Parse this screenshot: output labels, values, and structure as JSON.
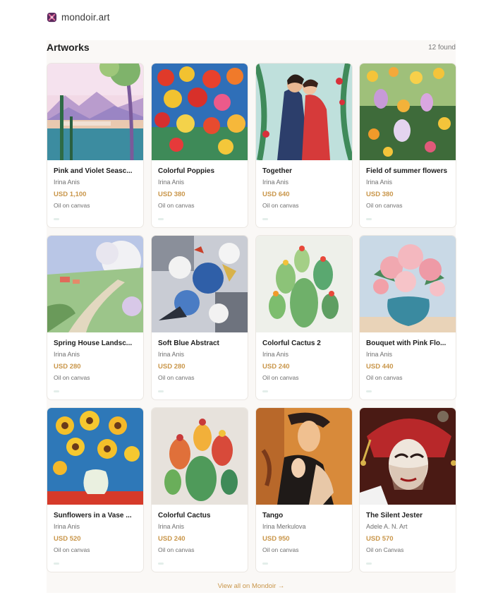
{
  "header": {
    "brand": "mondoir.art",
    "logo_icon": "logo-mark-icon"
  },
  "section": {
    "title": "Artworks",
    "count": "12 found"
  },
  "artworks": [
    {
      "title": "Pink and Violet Seasc...",
      "artist": "Irina Anis",
      "price": "USD 1,100",
      "medium": "Oil on canvas"
    },
    {
      "title": "Colorful Poppies",
      "artist": "Irina Anis",
      "price": "USD 380",
      "medium": "Oil on canvas"
    },
    {
      "title": "Together",
      "artist": "Irina Anis",
      "price": "USD 640",
      "medium": "Oil on canvas"
    },
    {
      "title": "Field of summer flowers",
      "artist": "Irina Anis",
      "price": "USD 380",
      "medium": "Oil on canvas"
    },
    {
      "title": "Spring House Landsc...",
      "artist": "Irina Anis",
      "price": "USD 280",
      "medium": "Oil on canvas"
    },
    {
      "title": "Soft Blue Abstract",
      "artist": "Irina Anis",
      "price": "USD 280",
      "medium": "Oil on canvas"
    },
    {
      "title": "Colorful Cactus 2",
      "artist": "Irina Anis",
      "price": "USD 240",
      "medium": "Oil on canvas"
    },
    {
      "title": "Bouquet with Pink Flo...",
      "artist": "Irina Anis",
      "price": "USD 440",
      "medium": "Oil on canvas"
    },
    {
      "title": "Sunflowers in a Vase ...",
      "artist": "Irina Anis",
      "price": "USD 520",
      "medium": "Oil on canvas"
    },
    {
      "title": "Colorful Cactus",
      "artist": "Irina Anis",
      "price": "USD 240",
      "medium": "Oil on canvas"
    },
    {
      "title": "Tango",
      "artist": "Irina Merkulova",
      "price": "USD 950",
      "medium": "Oil on canvas"
    },
    {
      "title": "The Silent Jester",
      "artist": "Adele A. N. Art",
      "price": "USD 570",
      "medium": "Oil on Canvas"
    }
  ],
  "footer": {
    "view_all": "View all on Mondoir →"
  },
  "colors": {
    "price": "#c9964a",
    "panel_bg": "#faf8f6",
    "logo": "#7b2d6e"
  }
}
